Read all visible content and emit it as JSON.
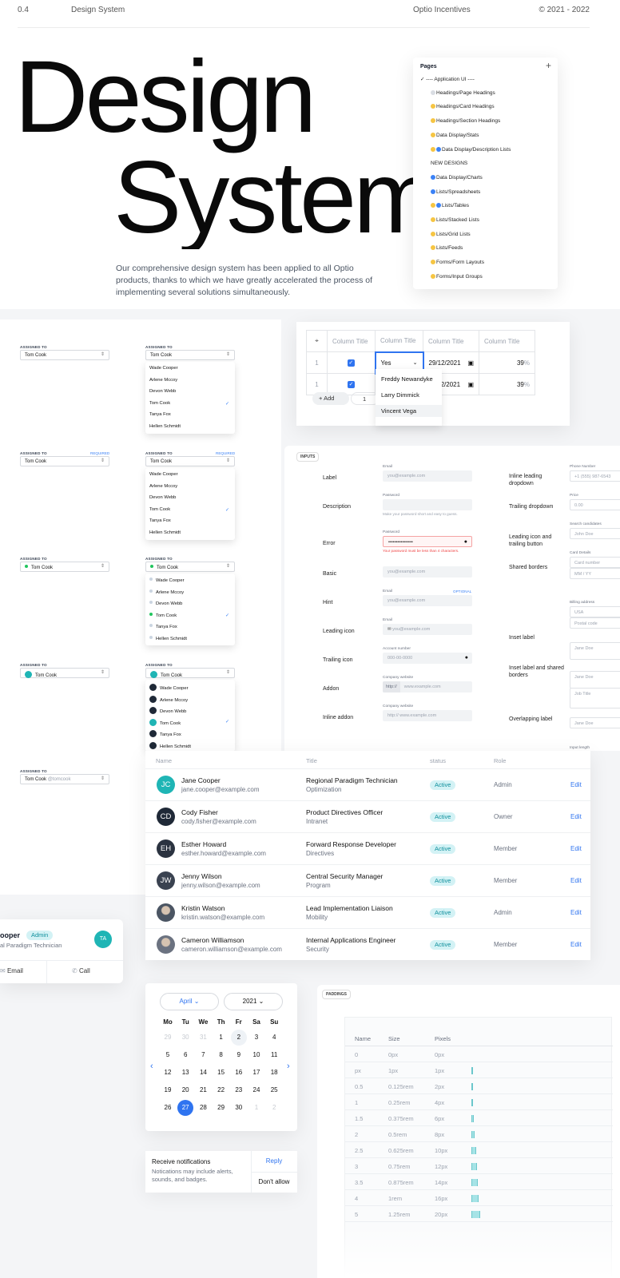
{
  "header": {
    "num": "0.4",
    "section": "Design System",
    "brand": "Optio Incentives",
    "years": "© 2021 - 2022"
  },
  "hero": {
    "line1": "Design",
    "line2": "System",
    "desc": "Our comprehensive design system has been applied to all Optio products, thanks to which we have greatly accelerated the process of implementing several solutions simultaneously."
  },
  "pages_panel": {
    "title": "Pages",
    "add": "+",
    "items": [
      {
        "label": "---- Application UI ----",
        "dot": "check"
      },
      {
        "label": "Headings/Page Headings",
        "dot": "grey"
      },
      {
        "label": "Headings/Card Headings",
        "dot": "yellow"
      },
      {
        "label": "Headings/Section Headings",
        "dot": "yellow"
      },
      {
        "label": "Data Display/Stats",
        "dot": "yellow"
      },
      {
        "label": "Data Display/Description Lists",
        "dot": "yellow-blue"
      },
      {
        "label": "NEW DESIGNS",
        "dot": "none"
      },
      {
        "label": "Data Display/Charts",
        "dot": "blue"
      },
      {
        "label": "Lists/Spreadsheets",
        "dot": "blue"
      },
      {
        "label": "Lists/Tables",
        "dot": "yellow-blue"
      },
      {
        "label": "Lists/Stacked Lists",
        "dot": "yellow"
      },
      {
        "label": "Lists/Grid Lists",
        "dot": "yellow"
      },
      {
        "label": "Lists/Feeds",
        "dot": "yellow"
      },
      {
        "label": "Forms/Form Layouts",
        "dot": "yellow"
      },
      {
        "label": "Forms/Input Groups",
        "dot": "yellow"
      }
    ]
  },
  "selects": {
    "assigned_label": "ASSIGNED TO",
    "required": "REQUIRED",
    "selected": "Tom Cook",
    "handle": "@tomcook",
    "people": [
      "Wade Cooper",
      "Arlene Mccoy",
      "Devon Webb",
      "Tom Cook",
      "Tanya Fox",
      "Hellen Schmidt"
    ],
    "chevron": "⌃"
  },
  "spreadsheet": {
    "columns": [
      "Column Title",
      "Column Title",
      "Column Title",
      "Column Title"
    ],
    "rows": [
      {
        "num": "1",
        "value": "Yes",
        "date": "29/12/2021",
        "pct": "39",
        "unit": "%"
      },
      {
        "num": "1",
        "value": "",
        "date": "29/12/2021",
        "pct": "39",
        "unit": "%"
      }
    ],
    "menu": [
      "Freddy Newandyke",
      "Larry Dimmick",
      "Vincent Vega"
    ],
    "add_label": "Add",
    "qty": "1"
  },
  "inputs": {
    "tag": "INPUTS",
    "left_rows": [
      {
        "label": "Label",
        "field_label": "Email",
        "value": "you@example.com",
        "hint": ""
      },
      {
        "label": "Description",
        "field_label": "Password",
        "value": "",
        "hint": "Make your password short and easy to guess."
      },
      {
        "label": "Error",
        "field_label": "Password",
        "value": "••••••••••••••••",
        "hint": "Your password must be less than 4 characters."
      },
      {
        "label": "Basic",
        "field_label": "",
        "value": "you@example.com",
        "hint": ""
      },
      {
        "label": "Hint",
        "field_label": "Email",
        "value": "you@example.com",
        "hint": ""
      },
      {
        "label": "Leading icon",
        "field_label": "Email",
        "value": "you@example.com",
        "hint": ""
      },
      {
        "label": "Trailing icon",
        "field_label": "Account number",
        "value": "000-00-0000",
        "hint": ""
      },
      {
        "label": "Addon",
        "field_label": "Company website",
        "value": "www.example.com",
        "hint": ""
      },
      {
        "label": "Inline addon",
        "field_label": "Company website",
        "value": "www.example.com",
        "hint": ""
      }
    ],
    "optional": "OPTIONAL",
    "addon_prefix": "http://",
    "right_rows": [
      {
        "label": "Inline leading dropdown"
      },
      {
        "label": "Trailing dropdown"
      },
      {
        "label": "Leading icon and trailing button"
      },
      {
        "label": "Shared borders"
      },
      {
        "label": "Inset label"
      },
      {
        "label": "Inset label and shared borders"
      },
      {
        "label": "Overlapping label"
      }
    ],
    "right_fields": {
      "phone_label": "Phone Number",
      "phone_country": "US",
      "phone_value": "+1 (555) 987-6543",
      "price_label": "Price",
      "price_value": "0.00",
      "price_symbol": "$",
      "search_label": "Search candidates",
      "search_value": "John Doe",
      "card_label": "Card Details",
      "card_number": "Card number",
      "card_exp": "MM / YY",
      "card_cvc": "CVC",
      "billing_label": "Billing address",
      "billing_country": "USA",
      "billing_postal": "Postal code",
      "name_label": "Name",
      "name_value": "Jane Doe",
      "job_label": "Job Title",
      "sub_label": "Input length"
    }
  },
  "users": {
    "headers": [
      "Name",
      "Title",
      "status",
      "Role"
    ],
    "rows": [
      {
        "initials": "JC",
        "avatar_color": "#1fb5b5",
        "name": "Jane Cooper",
        "email": "jane.cooper@example.com",
        "title": "Regional Paradigm Technician",
        "dept": "Optimization",
        "status": "Active",
        "role": "Admin",
        "action": "Edit"
      },
      {
        "initials": "CD",
        "avatar_color": "#1f2937",
        "name": "Cody Fisher",
        "email": "cody.fisher@example.com",
        "title": "Product Directives Officer",
        "dept": "Intranet",
        "status": "Active",
        "role": "Owner",
        "action": "Edit"
      },
      {
        "initials": "EH",
        "avatar_color": "#2b3340",
        "name": "Esther Howard",
        "email": "esther.howard@example.com",
        "title": "Forward Response Developer",
        "dept": "Directives",
        "status": "Active",
        "role": "Member",
        "action": "Edit"
      },
      {
        "initials": "JW",
        "avatar_color": "#3a4250",
        "name": "Jenny Wilson",
        "email": "jenny.wilson@example.com",
        "title": "Central Security Manager",
        "dept": "Program",
        "status": "Active",
        "role": "Member",
        "action": "Edit"
      },
      {
        "initials": "",
        "avatar_color": "#4b5563",
        "name": "Kristin Watson",
        "email": "kristin.watson@example.com",
        "title": "Lead Implementation Liaison",
        "dept": "Mobility",
        "status": "Active",
        "role": "Admin",
        "action": "Edit"
      },
      {
        "initials": "",
        "avatar_color": "#6b7280",
        "name": "Cameron Williamson",
        "email": "cameron.williamson@example.com",
        "title": "Internal Applications Engineer",
        "dept": "Security",
        "status": "Active",
        "role": "Member",
        "action": "Edit"
      }
    ]
  },
  "contact_card": {
    "name": "ooper",
    "badge": "Admin",
    "title": "al Paradigm Technician",
    "initials": "TA",
    "email": "Email",
    "call": "Call"
  },
  "calendar": {
    "month": "April",
    "year": "2021",
    "weekdays": [
      "Mo",
      "Tu",
      "We",
      "Th",
      "Fr",
      "Sa",
      "Su"
    ],
    "days": [
      [
        "29",
        "30",
        "31",
        "1",
        "2",
        "3",
        "4"
      ],
      [
        "5",
        "6",
        "7",
        "8",
        "9",
        "10",
        "11"
      ],
      [
        "12",
        "13",
        "14",
        "15",
        "16",
        "17",
        "18"
      ],
      [
        "19",
        "20",
        "21",
        "22",
        "23",
        "24",
        "25"
      ],
      [
        "26",
        "27",
        "28",
        "29",
        "30",
        "1",
        "2"
      ]
    ]
  },
  "notification": {
    "title": "Receive notifications",
    "body": "Notications may include alerts, sounds, and badges.",
    "reply": "Reply",
    "deny": "Don't allow"
  },
  "padding": {
    "tag": "PADDINGS",
    "headers": [
      "Name",
      "Size",
      "Pixels"
    ],
    "rows": [
      {
        "name": "0",
        "size": "0px",
        "px": "0px",
        "bar": 0
      },
      {
        "name": "px",
        "size": "1px",
        "px": "1px",
        "bar": 1
      },
      {
        "name": "0.5",
        "size": "0.125rem",
        "px": "2px",
        "bar": 2
      },
      {
        "name": "1",
        "size": "0.25rem",
        "px": "4px",
        "bar": 4
      },
      {
        "name": "1.5",
        "size": "0.375rem",
        "px": "6px",
        "bar": 6
      },
      {
        "name": "2",
        "size": "0.5rem",
        "px": "8px",
        "bar": 8
      },
      {
        "name": "2.5",
        "size": "0.625rem",
        "px": "10px",
        "bar": 10
      },
      {
        "name": "3",
        "size": "0.75rem",
        "px": "12px",
        "bar": 12
      },
      {
        "name": "3.5",
        "size": "0.875rem",
        "px": "14px",
        "bar": 14
      },
      {
        "name": "4",
        "size": "1rem",
        "px": "16px",
        "bar": 16
      },
      {
        "name": "5",
        "size": "1.25rem",
        "px": "20px",
        "bar": 20
      }
    ]
  },
  "colors": {
    "accent": "#2f74f0",
    "teal": "#1fb5b5",
    "badge_bg": "#d3f2f5",
    "badge_text": "#0e8f9c"
  }
}
